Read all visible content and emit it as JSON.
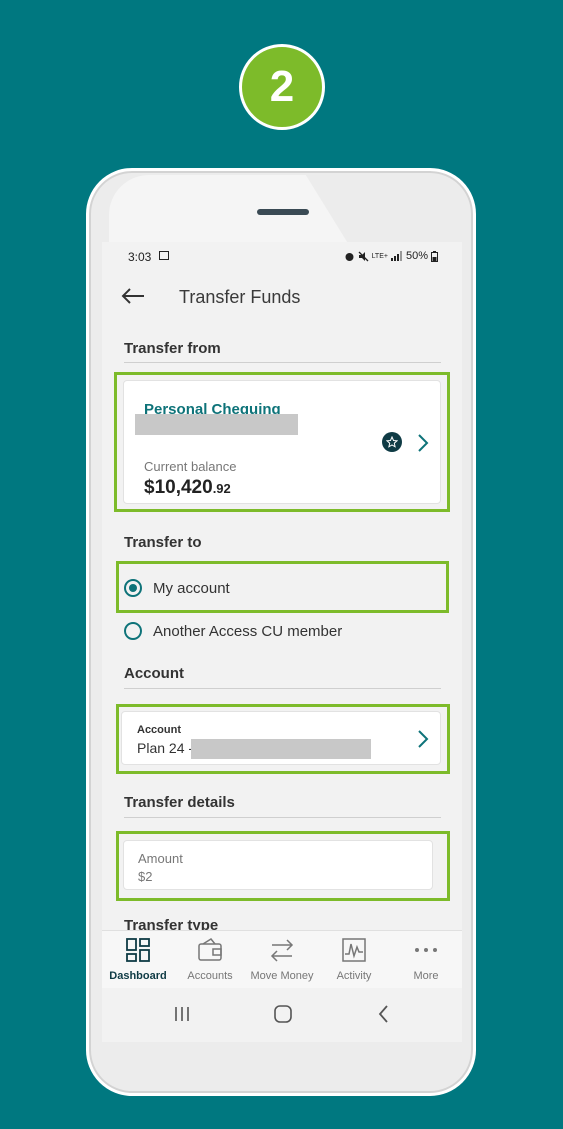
{
  "step_number": "2",
  "status_bar": {
    "time": "3:03",
    "battery": "50%",
    "network": "LTE+"
  },
  "header": {
    "title": "Transfer Funds"
  },
  "transfer_from": {
    "label": "Transfer from",
    "account_name": "Personal Chequing",
    "balance_label": "Current balance",
    "balance_main": "$10,420",
    "balance_cents": ".92"
  },
  "transfer_to": {
    "label": "Transfer to",
    "options": [
      {
        "label": "My account",
        "selected": true
      },
      {
        "label": "Another Access CU member",
        "selected": false
      }
    ]
  },
  "account": {
    "label": "Account",
    "field_label": "Account",
    "value_prefix": "Plan 24 -"
  },
  "transfer_details": {
    "label": "Transfer details",
    "amount_label": "Amount",
    "amount_value": "$2"
  },
  "transfer_type": {
    "label": "Transfer type"
  },
  "bottom_nav": [
    {
      "label": "Dashboard",
      "icon": "dashboard-icon",
      "active": true
    },
    {
      "label": "Accounts",
      "icon": "wallet-icon",
      "active": false
    },
    {
      "label": "Move Money",
      "icon": "transfer-arrows-icon",
      "active": false
    },
    {
      "label": "Activity",
      "icon": "activity-chart-icon",
      "active": false
    },
    {
      "label": "More",
      "icon": "more-dots-icon",
      "active": false
    }
  ],
  "colors": {
    "background": "#007880",
    "highlight": "#7dbb2a",
    "accent": "#0e7379",
    "nav_active": "#0f3b45"
  }
}
